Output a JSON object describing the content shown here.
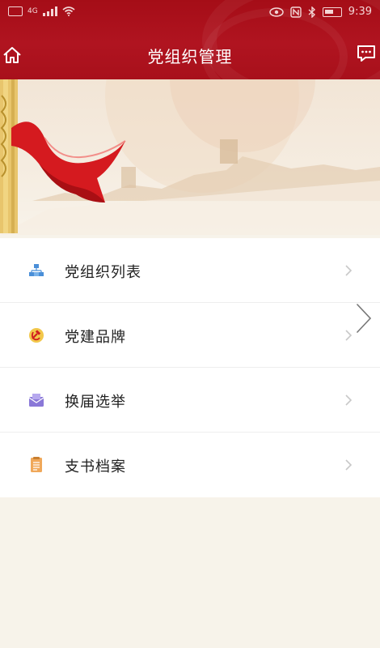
{
  "status_bar": {
    "network": "4G",
    "time": "9:39"
  },
  "header": {
    "title": "党组织管理",
    "home_icon": "home-icon",
    "message_icon": "message-icon"
  },
  "menu": {
    "items": [
      {
        "label": "党组织列表",
        "icon": "org-structure-icon"
      },
      {
        "label": "党建品牌",
        "icon": "hammer-sickle-icon"
      },
      {
        "label": "换届选举",
        "icon": "ballot-envelope-icon"
      },
      {
        "label": "支书档案",
        "icon": "file-archive-icon"
      }
    ]
  },
  "colors": {
    "header_red": "#a50d17",
    "page_bg": "#f7f3ea",
    "ribbon_red": "#d51a1f",
    "gold": "#e0b85a"
  }
}
